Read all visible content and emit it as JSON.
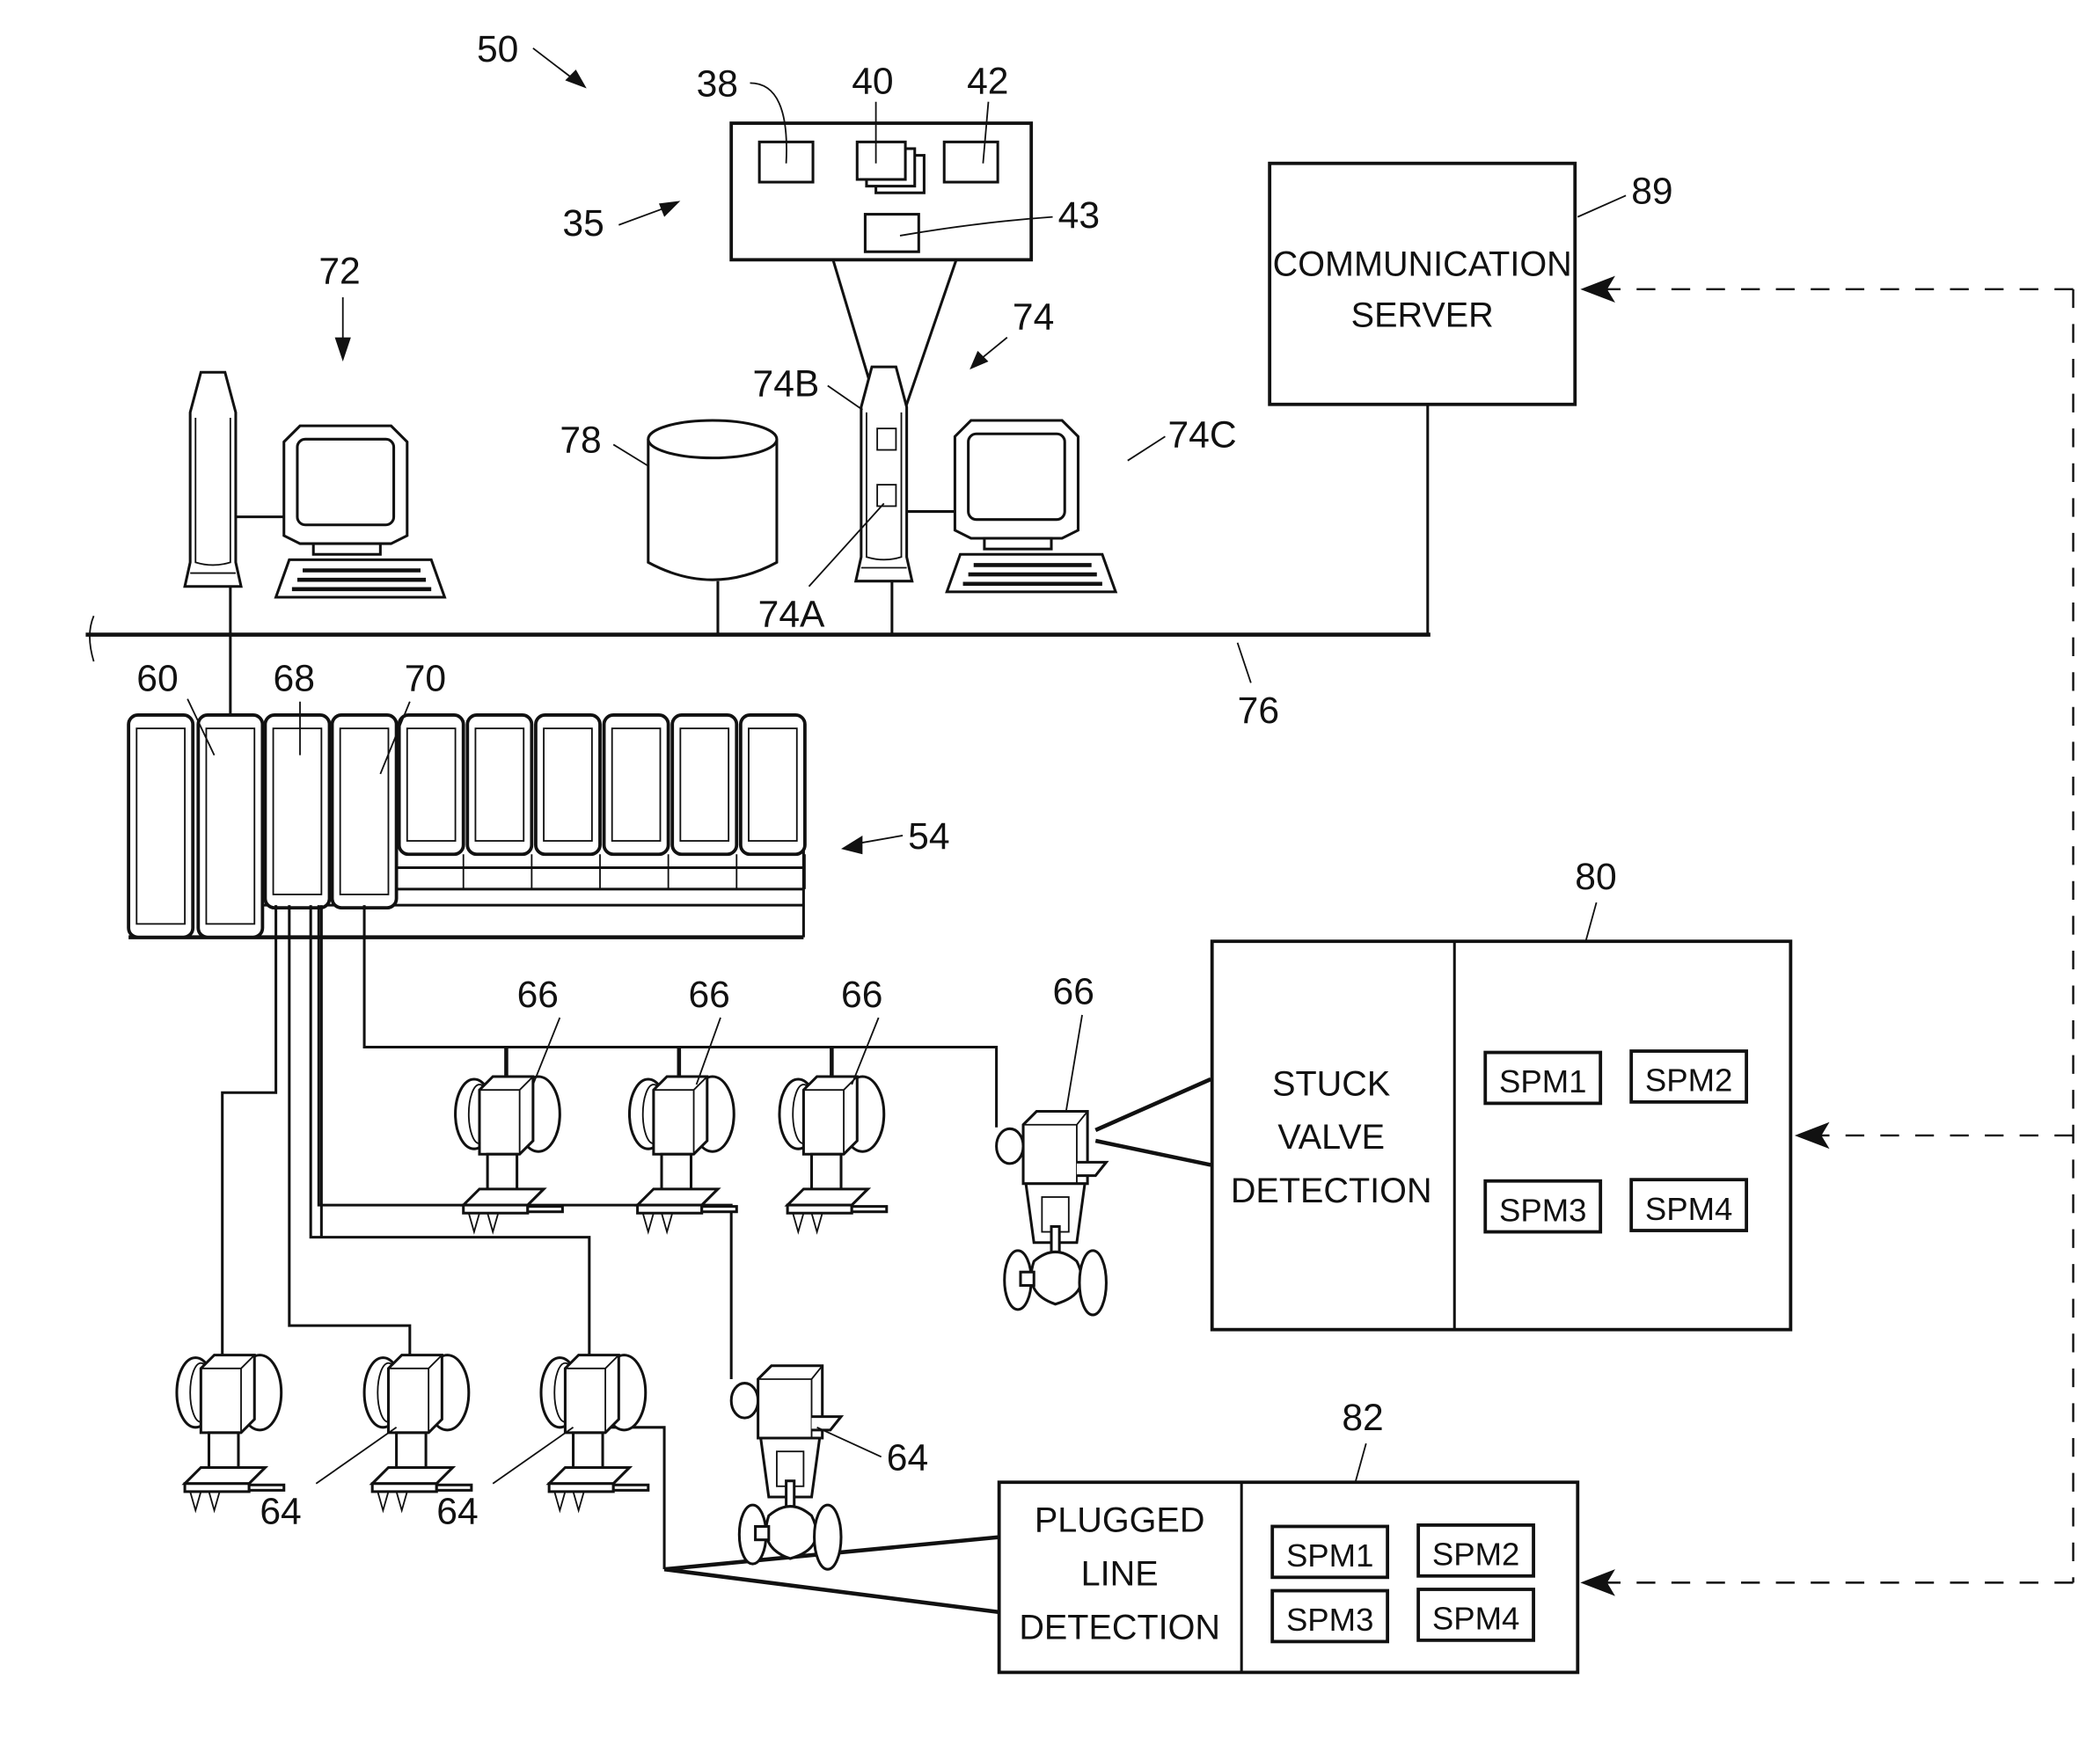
{
  "diagram": {
    "refs": {
      "system": "50",
      "memory": "35",
      "block38": "38",
      "block40": "40",
      "block42": "42",
      "block43": "43",
      "workstation72": "72",
      "workstation74": "74",
      "ref74A": "74A",
      "ref74B": "74B",
      "ref74C": "74C",
      "database": "78",
      "bus": "76",
      "server_ref": "89",
      "controller": "54",
      "card60": "60",
      "card68": "68",
      "card70": "70",
      "stuck_ref": "80",
      "plugged_ref": "82"
    },
    "devices66": [
      "66",
      "66",
      "66",
      "66"
    ],
    "devices64": [
      "64",
      "64",
      "64"
    ],
    "server": {
      "line1": "COMMUNICATION",
      "line2": "SERVER"
    },
    "stuck_valve": {
      "lines": [
        "STUCK",
        "VALVE",
        "DETECTION"
      ],
      "spms": [
        "SPM1",
        "SPM2",
        "SPM3",
        "SPM4"
      ]
    },
    "plugged_line": {
      "lines": [
        "PLUGGED",
        "LINE",
        "DETECTION"
      ],
      "spms": [
        "SPM1",
        "SPM2",
        "SPM3",
        "SPM4"
      ]
    }
  }
}
